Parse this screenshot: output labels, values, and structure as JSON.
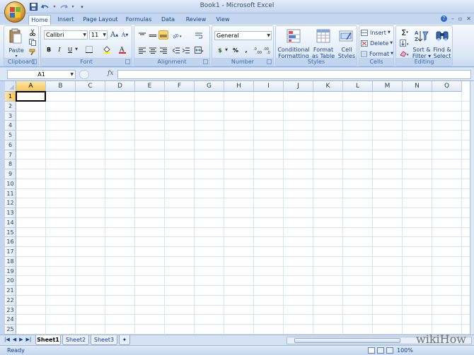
{
  "window": {
    "title": "Book1 - Microsoft Excel"
  },
  "tabs": [
    "Home",
    "Insert",
    "Page Layout",
    "Formulas",
    "Data",
    "Review",
    "View"
  ],
  "active_tab": "Home",
  "ribbon": {
    "clipboard": {
      "label": "Clipboard",
      "paste": "Paste"
    },
    "font": {
      "label": "Font",
      "family": "Calibri",
      "size": "11",
      "bold": "B",
      "italic": "I",
      "underline": "U"
    },
    "alignment": {
      "label": "Alignment"
    },
    "number": {
      "label": "Number",
      "format": "General",
      "currency": "$",
      "percent": "%",
      "comma": ","
    },
    "styles": {
      "label": "Styles",
      "conditional_formatting": [
        "Conditional",
        "Formatting"
      ],
      "format_as_table": [
        "Format",
        "as Table"
      ],
      "cell_styles": [
        "Cell",
        "Styles"
      ]
    },
    "cells": {
      "label": "Cells",
      "insert": "Insert",
      "delete": "Delete",
      "format": "Format"
    },
    "editing": {
      "label": "Editing",
      "sort_filter": [
        "Sort &",
        "Filter"
      ],
      "find_select": [
        "Find &",
        "Select"
      ]
    }
  },
  "formula_bar": {
    "name_box": "A1",
    "fx": "fx"
  },
  "columns": [
    "A",
    "B",
    "C",
    "D",
    "E",
    "F",
    "G",
    "H",
    "I",
    "J",
    "K",
    "L",
    "M",
    "N",
    "O"
  ],
  "rows": [
    "1",
    "2",
    "3",
    "4",
    "5",
    "6",
    "7",
    "8",
    "9",
    "10",
    "11",
    "12",
    "13",
    "14",
    "15",
    "16",
    "17",
    "18",
    "19",
    "20",
    "21",
    "22",
    "23",
    "24",
    "25"
  ],
  "sheets": [
    "Sheet1",
    "Sheet2",
    "Sheet3"
  ],
  "active_sheet": "Sheet1",
  "status": {
    "text": "Ready",
    "zoom": "100%"
  },
  "watermark": "wikiHow",
  "colors": {
    "accent": "#15428b",
    "ribbon_bg": "#dfe9f6",
    "selection": "#f6c65a"
  }
}
